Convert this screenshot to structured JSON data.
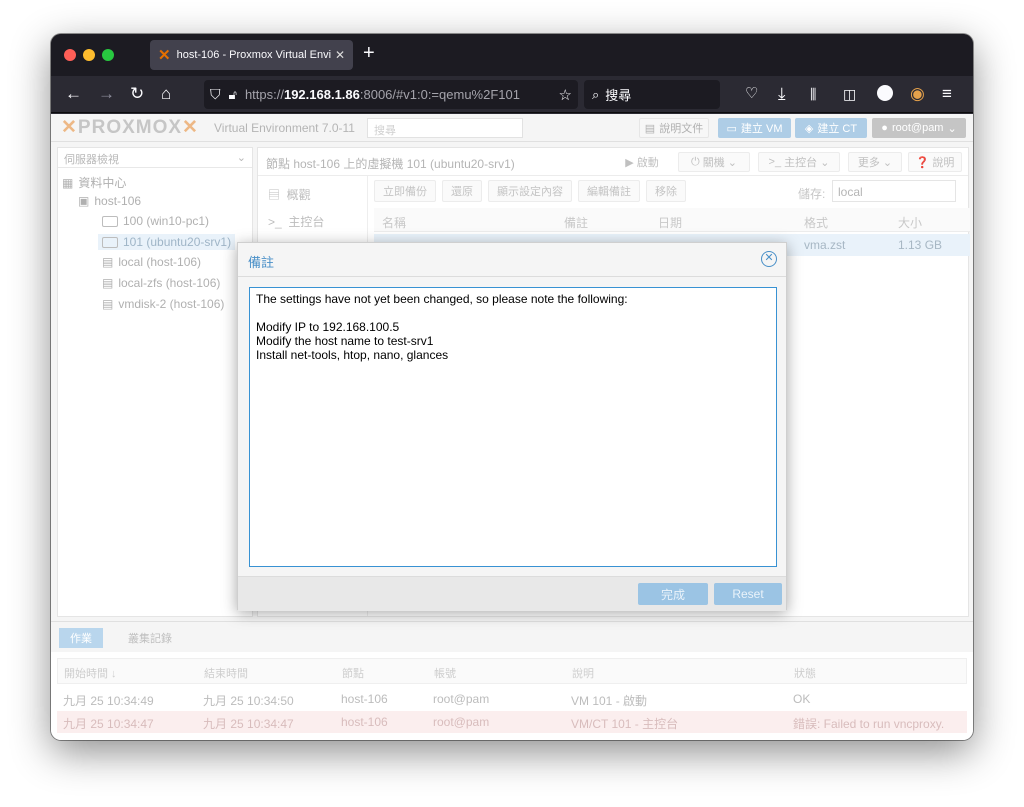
{
  "browser": {
    "tab_title": "host-106 - Proxmox Virtual Envi",
    "url_prefix": "https://",
    "url_host": "192.168.1.86",
    "url_rest": ":8006/#v1:0:=qemu%2F101",
    "search_placeholder": "搜尋"
  },
  "pve": {
    "logo_text": "PROXMOX",
    "version": "Virtual Environment 7.0-11",
    "search_placeholder": "搜尋",
    "doc_btn": "說明文件",
    "create_vm": "建立 VM",
    "create_ct": "建立 CT",
    "user": "root@pam",
    "view_selector": "伺服器檢視",
    "tree": {
      "datacenter": "資料中心",
      "node": "host-106",
      "vm100": "100 (win10-pc1)",
      "vm101": "101 (ubuntu20-srv1)",
      "storage_local": "local (host-106)",
      "storage_zfs": "local-zfs (host-106)",
      "storage_vmdisk": "vmdisk-2 (host-106)"
    },
    "main_title": "節點 host-106 上的虛擬機 101 (ubuntu20-srv1)",
    "main_buttons": {
      "start": "啟動",
      "shutdown": "關機",
      "console": "主控台",
      "more": "更多",
      "help": "說明"
    },
    "submenu": [
      "概觀",
      "主控台"
    ],
    "backup_toolbar": [
      "立即備份",
      "還原",
      "顯示設定內容",
      "編輯備註",
      "移除"
    ],
    "storage_label": "儲存:",
    "storage_value": "local",
    "grid_headers": {
      "name": "名稱",
      "notes": "備註",
      "date": "日期",
      "format": "格式",
      "size": "大小"
    },
    "grid_row": {
      "format": "vma.zst",
      "size": "1.13 GB"
    },
    "bottom_tabs": {
      "tasks": "作業",
      "cluster_log": "叢集記錄"
    },
    "task_headers": {
      "start": "開始時間",
      "end": "結束時間",
      "node": "節點",
      "user": "帳號",
      "desc": "說明",
      "status": "狀態"
    },
    "tasks": [
      {
        "start": "九月 25 10:34:49",
        "end": "九月 25 10:34:50",
        "node": "host-106",
        "user": "root@pam",
        "desc": "VM 101 - 啟動",
        "status": "OK"
      },
      {
        "start": "九月 25 10:34:47",
        "end": "九月 25 10:34:47",
        "node": "host-106",
        "user": "root@pam",
        "desc": "VM/CT 101 - 主控台",
        "status": "錯誤: Failed to run vncproxy."
      }
    ]
  },
  "modal": {
    "title": "備註",
    "notes": "The settings have not yet been changed, so please note the following:\n\nModify IP to 192.168.100.5\nModify the host name to test-srv1\nInstall net-tools, htop, nano, glances",
    "ok_label": "完成",
    "reset_label": "Reset"
  }
}
